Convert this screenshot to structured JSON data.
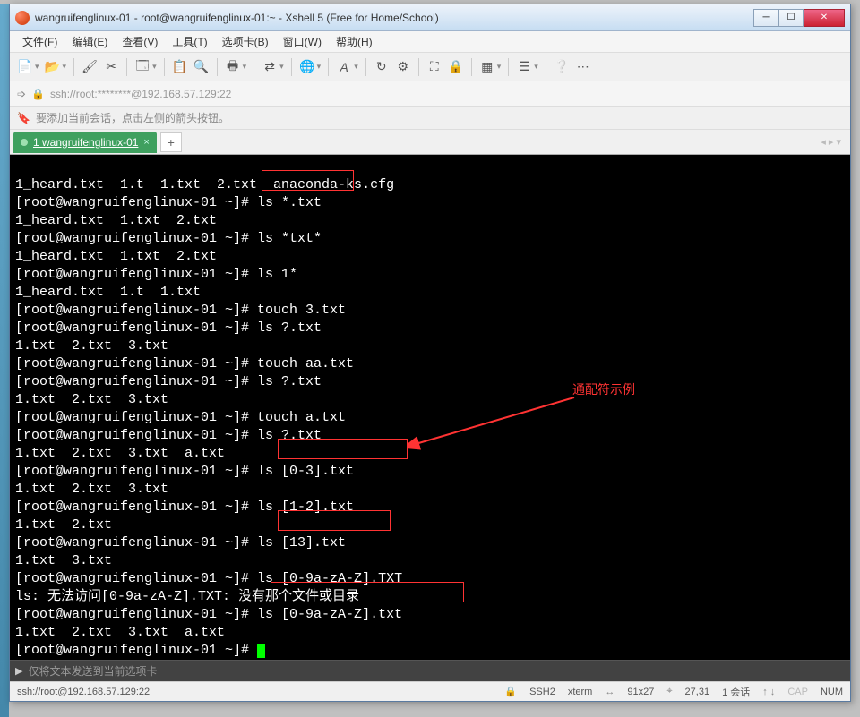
{
  "window": {
    "title": "wangruifenglinux-01 - root@wangruifenglinux-01:~ - Xshell 5 (Free for Home/School)"
  },
  "menu": {
    "file": "文件(F)",
    "edit": "编辑(E)",
    "view": "查看(V)",
    "tools": "工具(T)",
    "tabs": "选项卡(B)",
    "window": "窗口(W)",
    "help": "帮助(H)"
  },
  "address": {
    "url": "ssh://root:********@192.168.57.129:22"
  },
  "hint": {
    "text": "要添加当前会话，点击左侧的箭头按钮。"
  },
  "tab": {
    "label": "1 wangruifenglinux-01"
  },
  "terminal": {
    "lines": [
      "1_heard.txt  1.t  1.txt  2.txt  anaconda-ks.cfg",
      "[root@wangruifenglinux-01 ~]# ls *.txt",
      "1_heard.txt  1.txt  2.txt",
      "[root@wangruifenglinux-01 ~]# ls *txt*",
      "1_heard.txt  1.txt  2.txt",
      "[root@wangruifenglinux-01 ~]# ls 1*",
      "1_heard.txt  1.t  1.txt",
      "[root@wangruifenglinux-01 ~]# touch 3.txt",
      "[root@wangruifenglinux-01 ~]# ls ?.txt",
      "1.txt  2.txt  3.txt",
      "[root@wangruifenglinux-01 ~]# touch aa.txt",
      "[root@wangruifenglinux-01 ~]# ls ?.txt",
      "1.txt  2.txt  3.txt",
      "[root@wangruifenglinux-01 ~]# touch a.txt",
      "[root@wangruifenglinux-01 ~]# ls ?.txt",
      "1.txt  2.txt  3.txt  a.txt",
      "[root@wangruifenglinux-01 ~]# ls [0-3].txt",
      "1.txt  2.txt  3.txt",
      "[root@wangruifenglinux-01 ~]# ls [1-2].txt",
      "1.txt  2.txt",
      "[root@wangruifenglinux-01 ~]# ls [13].txt",
      "1.txt  3.txt",
      "[root@wangruifenglinux-01 ~]# ls [0-9a-zA-Z].TXT",
      "ls: 无法访问[0-9a-zA-Z].TXT: 没有那个文件或目录",
      "[root@wangruifenglinux-01 ~]# ls [0-9a-zA-Z].txt",
      "1.txt  2.txt  3.txt  a.txt",
      "[root@wangruifenglinux-01 ~]# "
    ]
  },
  "annotation": {
    "label": "通配符示例"
  },
  "inputrow": {
    "placeholder": "仅将文本发送到当前选项卡"
  },
  "status": {
    "conn": "ssh://root@192.168.57.129:22",
    "ssh": "SSH2",
    "term": "xterm",
    "size": "91x27",
    "pos": "27,31",
    "sessions": "1 会话",
    "caps": "CAP",
    "num": "NUM"
  }
}
